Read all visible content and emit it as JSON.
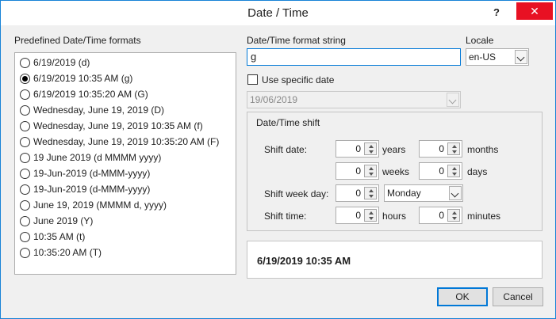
{
  "window": {
    "title": "Date / Time",
    "help_label": "?",
    "close_label": "✕"
  },
  "formats": {
    "heading": "Predefined Date/Time formats",
    "items": [
      {
        "label": "6/19/2019 (d)",
        "selected": false
      },
      {
        "label": "6/19/2019 10:35 AM (g)",
        "selected": true
      },
      {
        "label": "6/19/2019 10:35:20 AM (G)",
        "selected": false
      },
      {
        "label": "Wednesday, June 19, 2019 (D)",
        "selected": false
      },
      {
        "label": "Wednesday, June 19, 2019 10:35 AM (f)",
        "selected": false
      },
      {
        "label": "Wednesday, June 19, 2019 10:35:20 AM (F)",
        "selected": false
      },
      {
        "label": "19 June 2019 (d MMMM yyyy)",
        "selected": false
      },
      {
        "label": "19-Jun-2019 (d-MMM-yyyy)",
        "selected": false
      },
      {
        "label": "19-Jun-2019 (d-MMM-yyyy)",
        "selected": false
      },
      {
        "label": "June 19, 2019 (MMMM d, yyyy)",
        "selected": false
      },
      {
        "label": "June 2019 (Y)",
        "selected": false
      },
      {
        "label": "10:35 AM (t)",
        "selected": false
      },
      {
        "label": "10:35:20 AM (T)",
        "selected": false
      }
    ]
  },
  "format_string": {
    "label": "Date/Time format string",
    "value": "g"
  },
  "locale": {
    "label": "Locale",
    "value": "en-US"
  },
  "specific_date": {
    "label": "Use specific date",
    "checked": false,
    "value": "19/06/2019"
  },
  "shift": {
    "heading": "Date/Time shift",
    "shift_date_label": "Shift date:",
    "years_value": "0",
    "years_label": "years",
    "months_value": "0",
    "months_label": "months",
    "weeks_value": "0",
    "weeks_label": "weeks",
    "days_value": "0",
    "days_label": "days",
    "shift_week_day_label": "Shift week day:",
    "week_day_count": "0",
    "week_day_value": "Monday",
    "shift_time_label": "Shift time:",
    "hours_value": "0",
    "hours_label": "hours",
    "minutes_value": "0",
    "minutes_label": "minutes"
  },
  "preview": {
    "value": "6/19/2019 10:35 AM"
  },
  "buttons": {
    "ok": "OK",
    "cancel": "Cancel"
  }
}
